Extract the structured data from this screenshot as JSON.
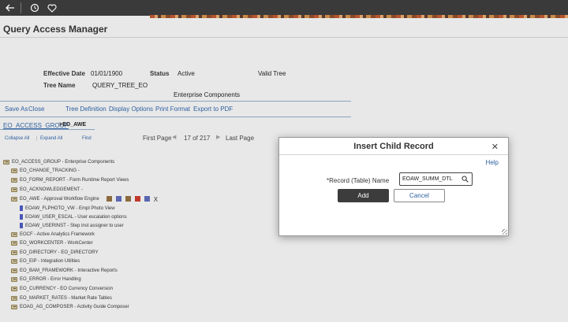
{
  "page": {
    "title": "Query Access Manager"
  },
  "header": {
    "effective_date_label": "Effective Date",
    "effective_date": "01/01/1900",
    "status_label": "Status",
    "status": "Active",
    "valid_tree": "Valid Tree",
    "tree_name_label": "Tree Name",
    "tree_name": "QUERY_TREE_EO",
    "description": "Enterprise Components"
  },
  "actions": {
    "save_as": "Save As",
    "close": "Close",
    "tree_definition": "Tree Definition",
    "display_options": "Display Options",
    "print_format": "Print Format",
    "export_pdf": "Export to PDF"
  },
  "breadcrumb": {
    "root": "EO_ACCESS_GROUP",
    "current": ">EO_AWE"
  },
  "tree_controls": {
    "collapse_all": "Collapse All",
    "expand_all": "Expand All",
    "find": "Find",
    "first_page": "First Page",
    "page_info": "17 of 217",
    "last_page": "Last Page"
  },
  "tree": [
    {
      "label": "EO_ACCESS_GROUP - Enterprise Components",
      "type": "folder",
      "level": 0
    },
    {
      "label": "EO_CHANGE_TRACKING -",
      "type": "folder",
      "level": 1
    },
    {
      "label": "EO_FORM_REPORT - Form Runtime Report Views",
      "type": "folder",
      "level": 1
    },
    {
      "label": "EO_ACKNOWLEDGEMENT -",
      "type": "folder",
      "level": 1
    },
    {
      "label": "EO_AWE - Approval Workflow Engine",
      "type": "folder",
      "level": 1
    },
    {
      "label": "EOAW_FLPHOTO_VW - Empl Photo View",
      "type": "record",
      "level": 2
    },
    {
      "label": "EOAW_USER_ESCAL - User escalation options",
      "type": "record",
      "level": 2
    },
    {
      "label": "EOAW_USERINST - Step inst assigner to user",
      "type": "record",
      "level": 2
    },
    {
      "label": "EOCF - Active Analytics Framework",
      "type": "folder",
      "level": 1
    },
    {
      "label": "EO_WORKCENTER - WorkCenter",
      "type": "folder",
      "level": 1
    },
    {
      "label": "EO_DIRECTORY - EO_DIRECTORY",
      "type": "folder",
      "level": 1
    },
    {
      "label": "EO_EIP - Integration Utilities",
      "type": "folder",
      "level": 1
    },
    {
      "label": "EO_BAM_FRAMEWORK - Interactive Reports",
      "type": "folder",
      "level": 1
    },
    {
      "label": "EO_ERROR - Error Handling",
      "type": "folder",
      "level": 1
    },
    {
      "label": "EO_CURRENCY - EO Currency Conversion",
      "type": "folder",
      "level": 1
    },
    {
      "label": "EO_MARKET_RATES - Market Rate Tables",
      "type": "folder",
      "level": 1
    },
    {
      "label": "EOAG_AG_COMPOSER - Activity Guide Composer",
      "type": "folder",
      "level": 1
    }
  ],
  "modal": {
    "title": "Insert Child Record",
    "help": "Help",
    "field_label": "Record (Table) Name",
    "field_required": "*",
    "field_value": "EOAW_SUMM_DTL",
    "add": "Add",
    "cancel": "Cancel"
  },
  "icons": [
    "back-arrow-icon",
    "history-icon",
    "favorite-heart-icon",
    "search-icon",
    "close-icon",
    "folder-icon",
    "record-icon"
  ]
}
